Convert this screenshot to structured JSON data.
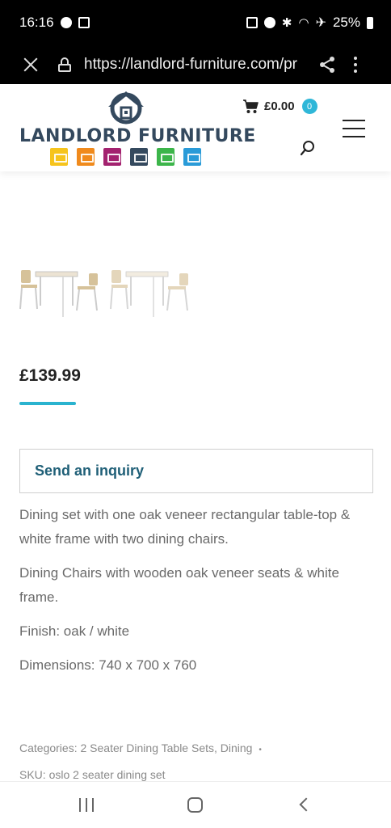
{
  "status_bar": {
    "time": "16:16",
    "battery": "25%"
  },
  "browser": {
    "url": "https://landlord-furniture.com/pr"
  },
  "site": {
    "brand": "LANDLORD FURNITURE",
    "tile_colors": [
      "#f6c41c",
      "#f08a1c",
      "#a3226f",
      "#34495e",
      "#3cb54a",
      "#2a9bd8"
    ],
    "cart_amount": "£0.00",
    "cart_count": "0"
  },
  "product": {
    "price": "£139.99",
    "inquiry_label": "Send an inquiry",
    "description": [
      "Dining set with one oak veneer rectangular table-top & white frame with two dining chairs.",
      "Dining Chairs with wooden oak veneer seats & white frame.",
      "Finish: oak / white",
      "Dimensions: 740 x 700 x 760"
    ],
    "categories_label": "Categories:",
    "categories": "2 Seater Dining Table Sets, Dining",
    "separator": "•",
    "sku_label": "SKU:",
    "sku": "oslo 2 seater dining set"
  },
  "colors": {
    "accent": "#2ab3cf",
    "brand_dark": "#34495e",
    "inquiry_text": "#1f5f77"
  }
}
